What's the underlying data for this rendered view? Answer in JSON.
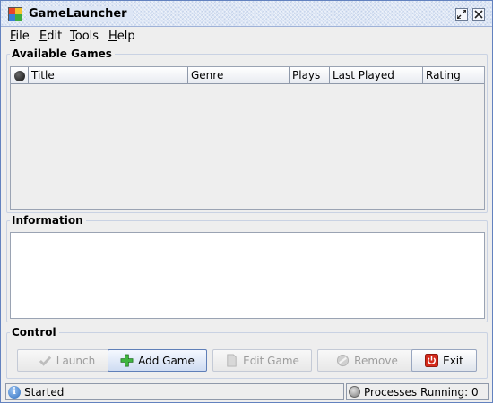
{
  "window": {
    "title": "GameLauncher",
    "icon": "game-launcher-icon",
    "controls": [
      "restore-icon",
      "close-icon"
    ]
  },
  "menu": {
    "file": {
      "mnemonic": "F",
      "rest": "ile"
    },
    "edit": {
      "mnemonic": "E",
      "rest": "dit"
    },
    "tools": {
      "mnemonic": "T",
      "rest": "ools"
    },
    "help": {
      "mnemonic": "H",
      "rest": "elp"
    }
  },
  "games_panel": {
    "title": "Available Games",
    "columns": [
      "Title",
      "Genre",
      "Plays",
      "Last Played",
      "Rating"
    ],
    "rows": []
  },
  "info_panel": {
    "title": "Information",
    "text": ""
  },
  "control_panel": {
    "title": "Control",
    "buttons": {
      "launch": {
        "label": "Launch",
        "icon": "checkmark-icon",
        "enabled": false
      },
      "add": {
        "label": "Add Game",
        "icon": "plus-icon",
        "enabled": true
      },
      "edit": {
        "label": "Edit Game",
        "icon": "document-icon",
        "enabled": false
      },
      "remove": {
        "label": "Remove",
        "icon": "no-entry-icon",
        "enabled": false
      },
      "exit": {
        "label": "Exit",
        "icon": "power-icon",
        "enabled": true
      }
    }
  },
  "status": {
    "message": "Started",
    "processes_label": "Processes Running: 0"
  },
  "colors": {
    "window_border": "#6382bf",
    "titlebar": "#dde6f5",
    "panel": "#eeeeee",
    "exit_icon": "#d42a1c",
    "add_icon": "#2fa12f"
  }
}
